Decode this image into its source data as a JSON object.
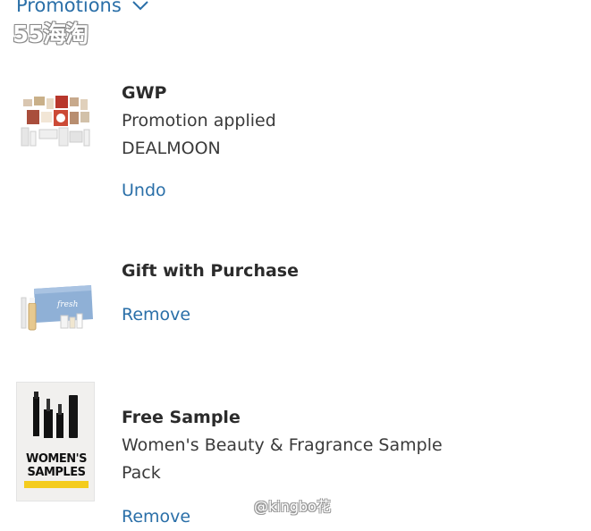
{
  "header": {
    "title": "Promotions",
    "watermark": "55海淘"
  },
  "promotions": [
    {
      "title": "GWP",
      "lines": [
        "Promotion applied",
        "DEALMOON"
      ],
      "action": "Undo",
      "thumb_icon": "gift-set-collage"
    },
    {
      "title": "Gift with Purchase",
      "lines": [],
      "action": "Remove",
      "thumb_icon": "fresh-pouch-set",
      "brand_text": "fresh"
    },
    {
      "title": "Free Sample",
      "lines": [
        "Women's Beauty & Fragrance Sample",
        "Pack"
      ],
      "action": "Remove",
      "thumb_icon": "womens-samples-card",
      "thumb_text_1": "WOMEN'S",
      "thumb_text_2": "SAMPLES"
    }
  ],
  "watermark_user": "@kingbo花",
  "colors": {
    "link": "#2a6fa8",
    "text": "#2b2b2b",
    "accent_yellow": "#f4cc1e"
  }
}
